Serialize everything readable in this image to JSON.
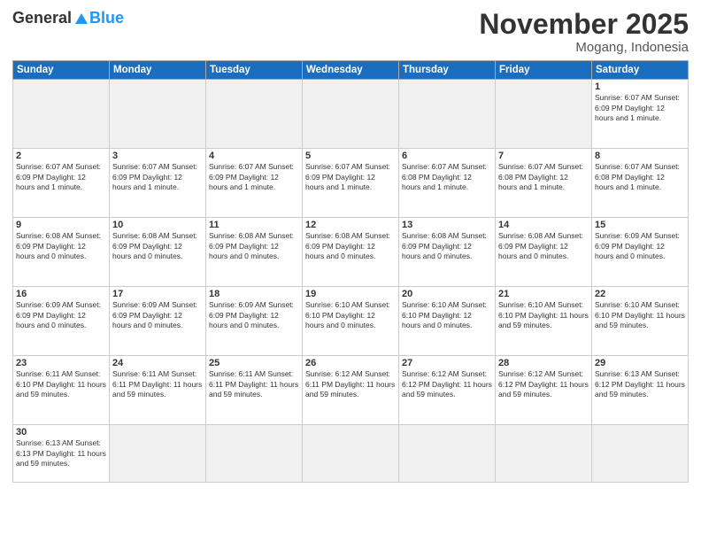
{
  "logo": {
    "general": "General",
    "blue": "Blue"
  },
  "title": "November 2025",
  "location": "Mogang, Indonesia",
  "days_of_week": [
    "Sunday",
    "Monday",
    "Tuesday",
    "Wednesday",
    "Thursday",
    "Friday",
    "Saturday"
  ],
  "weeks": [
    [
      {
        "day": "",
        "info": ""
      },
      {
        "day": "",
        "info": ""
      },
      {
        "day": "",
        "info": ""
      },
      {
        "day": "",
        "info": ""
      },
      {
        "day": "",
        "info": ""
      },
      {
        "day": "",
        "info": ""
      },
      {
        "day": "1",
        "info": "Sunrise: 6:07 AM\nSunset: 6:09 PM\nDaylight: 12 hours and 1 minute."
      }
    ],
    [
      {
        "day": "2",
        "info": "Sunrise: 6:07 AM\nSunset: 6:09 PM\nDaylight: 12 hours and 1 minute."
      },
      {
        "day": "3",
        "info": "Sunrise: 6:07 AM\nSunset: 6:09 PM\nDaylight: 12 hours and 1 minute."
      },
      {
        "day": "4",
        "info": "Sunrise: 6:07 AM\nSunset: 6:09 PM\nDaylight: 12 hours and 1 minute."
      },
      {
        "day": "5",
        "info": "Sunrise: 6:07 AM\nSunset: 6:09 PM\nDaylight: 12 hours and 1 minute."
      },
      {
        "day": "6",
        "info": "Sunrise: 6:07 AM\nSunset: 6:08 PM\nDaylight: 12 hours and 1 minute."
      },
      {
        "day": "7",
        "info": "Sunrise: 6:07 AM\nSunset: 6:08 PM\nDaylight: 12 hours and 1 minute."
      },
      {
        "day": "8",
        "info": "Sunrise: 6:07 AM\nSunset: 6:08 PM\nDaylight: 12 hours and 1 minute."
      }
    ],
    [
      {
        "day": "9",
        "info": "Sunrise: 6:08 AM\nSunset: 6:09 PM\nDaylight: 12 hours and 0 minutes."
      },
      {
        "day": "10",
        "info": "Sunrise: 6:08 AM\nSunset: 6:09 PM\nDaylight: 12 hours and 0 minutes."
      },
      {
        "day": "11",
        "info": "Sunrise: 6:08 AM\nSunset: 6:09 PM\nDaylight: 12 hours and 0 minutes."
      },
      {
        "day": "12",
        "info": "Sunrise: 6:08 AM\nSunset: 6:09 PM\nDaylight: 12 hours and 0 minutes."
      },
      {
        "day": "13",
        "info": "Sunrise: 6:08 AM\nSunset: 6:09 PM\nDaylight: 12 hours and 0 minutes."
      },
      {
        "day": "14",
        "info": "Sunrise: 6:08 AM\nSunset: 6:09 PM\nDaylight: 12 hours and 0 minutes."
      },
      {
        "day": "15",
        "info": "Sunrise: 6:09 AM\nSunset: 6:09 PM\nDaylight: 12 hours and 0 minutes."
      }
    ],
    [
      {
        "day": "16",
        "info": "Sunrise: 6:09 AM\nSunset: 6:09 PM\nDaylight: 12 hours and 0 minutes."
      },
      {
        "day": "17",
        "info": "Sunrise: 6:09 AM\nSunset: 6:09 PM\nDaylight: 12 hours and 0 minutes."
      },
      {
        "day": "18",
        "info": "Sunrise: 6:09 AM\nSunset: 6:09 PM\nDaylight: 12 hours and 0 minutes."
      },
      {
        "day": "19",
        "info": "Sunrise: 6:10 AM\nSunset: 6:10 PM\nDaylight: 12 hours and 0 minutes."
      },
      {
        "day": "20",
        "info": "Sunrise: 6:10 AM\nSunset: 6:10 PM\nDaylight: 12 hours and 0 minutes."
      },
      {
        "day": "21",
        "info": "Sunrise: 6:10 AM\nSunset: 6:10 PM\nDaylight: 11 hours and 59 minutes."
      },
      {
        "day": "22",
        "info": "Sunrise: 6:10 AM\nSunset: 6:10 PM\nDaylight: 11 hours and 59 minutes."
      }
    ],
    [
      {
        "day": "23",
        "info": "Sunrise: 6:11 AM\nSunset: 6:10 PM\nDaylight: 11 hours and 59 minutes."
      },
      {
        "day": "24",
        "info": "Sunrise: 6:11 AM\nSunset: 6:11 PM\nDaylight: 11 hours and 59 minutes."
      },
      {
        "day": "25",
        "info": "Sunrise: 6:11 AM\nSunset: 6:11 PM\nDaylight: 11 hours and 59 minutes."
      },
      {
        "day": "26",
        "info": "Sunrise: 6:12 AM\nSunset: 6:11 PM\nDaylight: 11 hours and 59 minutes."
      },
      {
        "day": "27",
        "info": "Sunrise: 6:12 AM\nSunset: 6:12 PM\nDaylight: 11 hours and 59 minutes."
      },
      {
        "day": "28",
        "info": "Sunrise: 6:12 AM\nSunset: 6:12 PM\nDaylight: 11 hours and 59 minutes."
      },
      {
        "day": "29",
        "info": "Sunrise: 6:13 AM\nSunset: 6:12 PM\nDaylight: 11 hours and 59 minutes."
      }
    ],
    [
      {
        "day": "30",
        "info": "Sunrise: 6:13 AM\nSunset: 6:13 PM\nDaylight: 11 hours and 59 minutes."
      },
      {
        "day": "",
        "info": ""
      },
      {
        "day": "",
        "info": ""
      },
      {
        "day": "",
        "info": ""
      },
      {
        "day": "",
        "info": ""
      },
      {
        "day": "",
        "info": ""
      },
      {
        "day": "",
        "info": ""
      }
    ]
  ]
}
